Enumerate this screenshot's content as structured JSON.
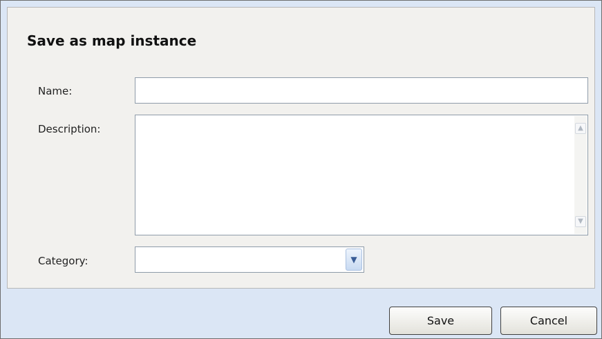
{
  "dialog": {
    "title": "Save as map instance"
  },
  "form": {
    "name_label": "Name:",
    "name_value": "",
    "description_label": "Description:",
    "description_value": "",
    "category_label": "Category:",
    "category_value": ""
  },
  "icons": {
    "scroll_up": "chevron-up-icon",
    "scroll_down": "chevron-down-icon",
    "dropdown": "chevron-down-icon"
  },
  "buttons": {
    "save_label": "Save",
    "cancel_label": "Cancel"
  }
}
